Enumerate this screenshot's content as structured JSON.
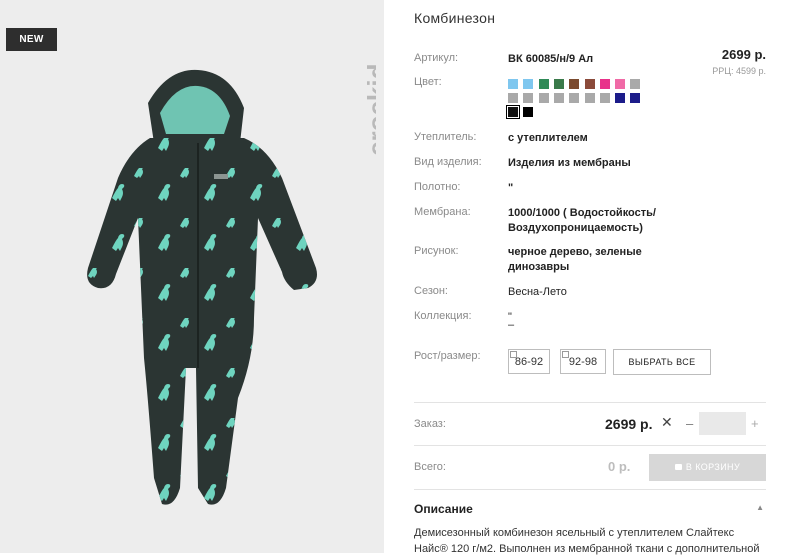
{
  "badge": "NEW",
  "brand": "crockid",
  "title": "Комбинезон",
  "price": "2699 р.",
  "rrp": "РРЦ: 4599 р.",
  "details": [
    {
      "label": "Артикул:",
      "value": "ВК 60085/н/9 Ал"
    },
    {
      "label": "Цвет:",
      "value": ""
    },
    {
      "label": "Утеплитель:",
      "value": "с утеплителем"
    },
    {
      "label": "Вид изделия:",
      "value": "Изделия из мембраны"
    },
    {
      "label": "Полотно:",
      "value": "\""
    },
    {
      "label": "Мембрана:",
      "value_line1": "1000/1000 ( Водостойкость/",
      "value_line2": "Воздухопроницаемость)"
    },
    {
      "label": "Рисунок:",
      "value_line1": "черное дерево, зеленые",
      "value_line2": "динозавры"
    },
    {
      "label": "Сезон:",
      "value": "Весна-Лето"
    },
    {
      "label": "Коллекция:",
      "value_line1": "\"",
      "value_line2": "–"
    },
    {
      "label": "Рост/размер:",
      "value": ""
    }
  ],
  "swatch_colors": [
    "#7fc7ef",
    "#7fc7ef",
    "#2f8a57",
    "#3a7a4a",
    "#7b4a2e",
    "#8b4a3a",
    "#e8328a",
    "#f06aa6",
    "#a9a9a9",
    "#a9a9a9",
    "#a9a9a9",
    "#a9a9a9",
    "#a9a9a9",
    "#a9a9a9",
    "#a9a9a9",
    "#a9a9a9",
    "#1c1c8a",
    "#1c1c8a",
    "#111111",
    "#000000"
  ],
  "selected_swatch": 18,
  "sizes": [
    "86-92",
    "92-98"
  ],
  "select_all": "ВЫБРАТЬ ВСЕ",
  "order": {
    "label": "Заказ:",
    "price": "2699 р.",
    "remove": "✕",
    "minus": "–",
    "plus": "+",
    "qty": ""
  },
  "total": {
    "label": "Всего:",
    "value": "0 р.",
    "cart_button": "В КОРЗИНУ"
  },
  "description": {
    "title": "Описание",
    "toggle": "▲",
    "text_line1": "Демисезонный комбинезон ясельный с утеплителем Слайтекс Найс® 120 г/м2. Выполнен из мембранной ткани с дополнительной"
  }
}
